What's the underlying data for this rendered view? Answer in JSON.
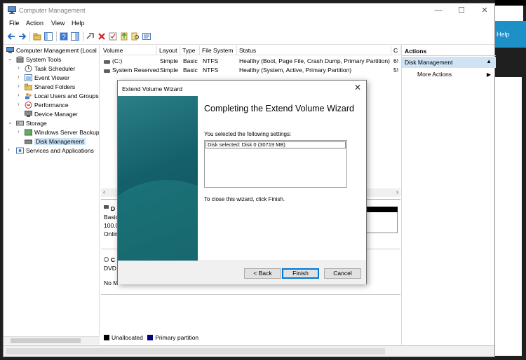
{
  "window": {
    "title": "Computer Management"
  },
  "background": {
    "help_label": "Help"
  },
  "menu": [
    "File",
    "Action",
    "View",
    "Help"
  ],
  "tree": [
    {
      "label": "Computer Management (Local",
      "level": 0,
      "arrow": ""
    },
    {
      "label": "System Tools",
      "level": 1,
      "arrow": "⌄"
    },
    {
      "label": "Task Scheduler",
      "level": 2,
      "arrow": "›"
    },
    {
      "label": "Event Viewer",
      "level": 2,
      "arrow": "›"
    },
    {
      "label": "Shared Folders",
      "level": 2,
      "arrow": "›"
    },
    {
      "label": "Local Users and Groups",
      "level": 2,
      "arrow": "›"
    },
    {
      "label": "Performance",
      "level": 2,
      "arrow": "›"
    },
    {
      "label": "Device Manager",
      "level": 2,
      "arrow": ""
    },
    {
      "label": "Storage",
      "level": 1,
      "arrow": "⌄"
    },
    {
      "label": "Windows Server Backup",
      "level": 2,
      "arrow": "›"
    },
    {
      "label": "Disk Management",
      "level": 2,
      "arrow": "",
      "selected": true
    },
    {
      "label": "Services and Applications",
      "level": 1,
      "arrow": "›"
    }
  ],
  "volume_table": {
    "columns": [
      "Volume",
      "Layout",
      "Type",
      "File System",
      "Status",
      "C"
    ],
    "rows": [
      [
        "(C:)",
        "Simple",
        "Basic",
        "NTFS",
        "Healthy (Boot, Page File, Crash Dump, Primary Partition)",
        "6!"
      ],
      [
        "System Reserved",
        "Simple",
        "Basic",
        "NTFS",
        "Healthy (System, Active, Primary Partition)",
        "5!"
      ]
    ]
  },
  "lower_pane": {
    "disk0": [
      "D",
      "Basic",
      "100.0",
      "Onlin"
    ],
    "cdrom": [
      "C",
      "DVD",
      "No M"
    ]
  },
  "legend": [
    {
      "label": "Unallocated",
      "color": "#000000"
    },
    {
      "label": "Primary partition",
      "color": "#000080"
    }
  ],
  "actions": {
    "header": "Actions",
    "selected": "Disk Management",
    "items": [
      "More Actions"
    ]
  },
  "dialog": {
    "title": "Extend Volume Wizard",
    "heading": "Completing the Extend Volume Wizard",
    "settings_intro": "You selected the following settings:",
    "settings": [
      "Disk selected: Disk 0 (30719 MB)"
    ],
    "close_text": "To close this wizard, click Finish.",
    "buttons": {
      "back": "< Back",
      "finish": "Finish",
      "cancel": "Cancel"
    }
  }
}
